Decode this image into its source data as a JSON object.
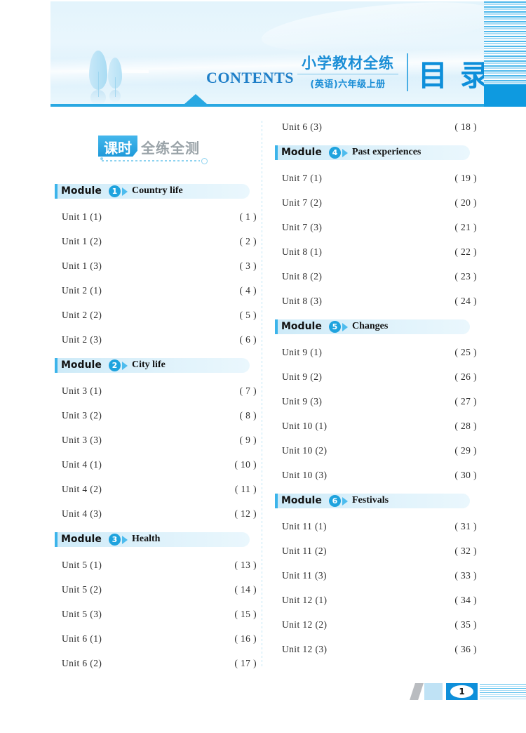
{
  "header": {
    "contents_word": "CONTENTS",
    "title_cn_main": "小学教材全练",
    "title_cn_sub": "(英语)六年级上册",
    "title_mulu": "目录"
  },
  "section_badge": {
    "tag_text": "课时",
    "rest_text": "全练全测"
  },
  "colors": {
    "accent_blue": "#0e8fda",
    "light_blue": "#bfe2f5",
    "rule_blue": "#29a8e2",
    "text_dark": "#2b2b2b",
    "gray_text": "#9aa3a8"
  },
  "left_column": [
    {
      "type": "module",
      "word": "Module",
      "number": "1",
      "title": "Country life"
    },
    {
      "type": "entry",
      "label": "Unit 1 (1)",
      "page": "( 1 )"
    },
    {
      "type": "entry",
      "label": "Unit 1 (2)",
      "page": "( 2 )"
    },
    {
      "type": "entry",
      "label": "Unit 1 (3)",
      "page": "( 3 )"
    },
    {
      "type": "entry",
      "label": "Unit 2 (1)",
      "page": "( 4 )"
    },
    {
      "type": "entry",
      "label": "Unit 2 (2)",
      "page": "( 5 )"
    },
    {
      "type": "entry",
      "label": "Unit 2 (3)",
      "page": "( 6 )"
    },
    {
      "type": "module",
      "word": "Module",
      "number": "2",
      "title": "City life"
    },
    {
      "type": "entry",
      "label": "Unit 3 (1)",
      "page": "( 7 )"
    },
    {
      "type": "entry",
      "label": "Unit 3 (2)",
      "page": "( 8 )"
    },
    {
      "type": "entry",
      "label": "Unit 3 (3)",
      "page": "( 9 )"
    },
    {
      "type": "entry",
      "label": "Unit 4 (1)",
      "page": "( 10 )"
    },
    {
      "type": "entry",
      "label": "Unit 4 (2)",
      "page": "( 11 )"
    },
    {
      "type": "entry",
      "label": "Unit 4 (3)",
      "page": "( 12 )"
    },
    {
      "type": "module",
      "word": "Module",
      "number": "3",
      "title": "Health"
    },
    {
      "type": "entry",
      "label": "Unit 5 (1)",
      "page": "( 13 )"
    },
    {
      "type": "entry",
      "label": "Unit 5 (2)",
      "page": "( 14 )"
    },
    {
      "type": "entry",
      "label": "Unit 5 (3)",
      "page": "( 15 )"
    },
    {
      "type": "entry",
      "label": "Unit 6 (1)",
      "page": "( 16 )"
    },
    {
      "type": "entry",
      "label": "Unit 6 (2)",
      "page": "( 17 )"
    }
  ],
  "right_column": [
    {
      "type": "entry",
      "label": "Unit 6 (3)",
      "page": "( 18 )"
    },
    {
      "type": "module",
      "word": "Module",
      "number": "4",
      "title": "Past experiences"
    },
    {
      "type": "entry",
      "label": "Unit 7 (1)",
      "page": "( 19 )"
    },
    {
      "type": "entry",
      "label": "Unit 7 (2)",
      "page": "( 20 )"
    },
    {
      "type": "entry",
      "label": "Unit 7 (3)",
      "page": "( 21 )"
    },
    {
      "type": "entry",
      "label": "Unit 8 (1)",
      "page": "( 22 )"
    },
    {
      "type": "entry",
      "label": "Unit 8 (2)",
      "page": "( 23 )"
    },
    {
      "type": "entry",
      "label": "Unit 8 (3)",
      "page": "( 24 )"
    },
    {
      "type": "module",
      "word": "Module",
      "number": "5",
      "title": "Changes"
    },
    {
      "type": "entry",
      "label": "Unit 9 (1)",
      "page": "( 25 )"
    },
    {
      "type": "entry",
      "label": "Unit 9 (2)",
      "page": "( 26 )"
    },
    {
      "type": "entry",
      "label": "Unit 9 (3)",
      "page": "( 27 )"
    },
    {
      "type": "entry",
      "label": "Unit 10 (1)",
      "page": "( 28 )"
    },
    {
      "type": "entry",
      "label": "Unit 10 (2)",
      "page": "( 29 )"
    },
    {
      "type": "entry",
      "label": "Unit 10 (3)",
      "page": "( 30 )"
    },
    {
      "type": "module",
      "word": "Module",
      "number": "6",
      "title": "Festivals"
    },
    {
      "type": "entry",
      "label": "Unit 11 (1)",
      "page": "( 31 )"
    },
    {
      "type": "entry",
      "label": "Unit 11 (2)",
      "page": "( 32 )"
    },
    {
      "type": "entry",
      "label": "Unit 11 (3)",
      "page": "( 33 )"
    },
    {
      "type": "entry",
      "label": "Unit 12 (1)",
      "page": "( 34 )"
    },
    {
      "type": "entry",
      "label": "Unit 12 (2)",
      "page": "( 35 )"
    },
    {
      "type": "entry",
      "label": "Unit 12 (3)",
      "page": "( 36 )"
    }
  ],
  "footer": {
    "page_number": "1"
  }
}
